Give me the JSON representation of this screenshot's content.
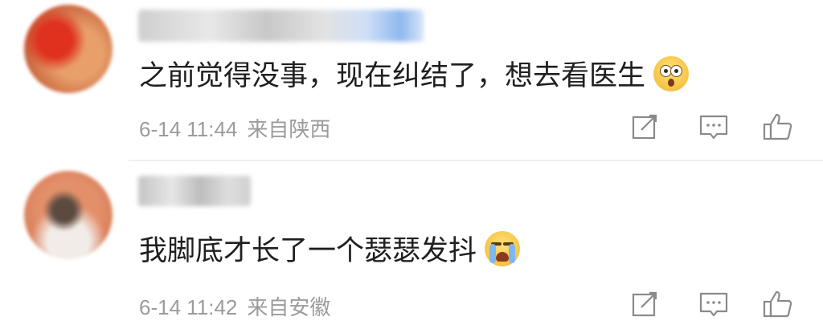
{
  "comments": [
    {
      "text": "之前觉得没事，现在纠结了，想去看医生",
      "emoji": "flushed-face-emoji",
      "time": "6-14 11:44",
      "location": "来自陕西"
    },
    {
      "text": "我脚底才长了一个瑟瑟发抖",
      "emoji": "crying-face-emoji",
      "time": "6-14 11:42",
      "location": "来自安徽"
    }
  ],
  "icons": {
    "share": "share-icon",
    "comment": "comment-icon",
    "like": "thumbs-up-icon"
  },
  "colors": {
    "meta_text": "#9b9b9b",
    "content_text": "#1f1f1f",
    "icon_stroke": "#8a8a8a"
  }
}
